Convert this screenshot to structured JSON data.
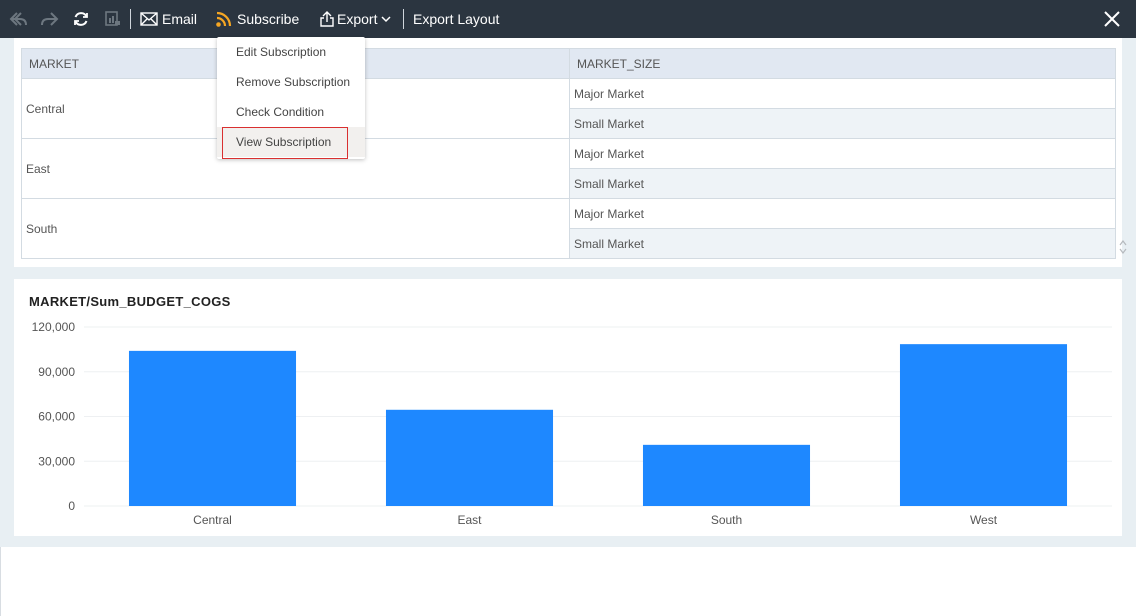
{
  "toolbar": {
    "undo_label": "Undo",
    "redo_label": "Redo",
    "refresh_label": "Refresh",
    "email_label": "Email",
    "subscribe_label": "Subscribe",
    "export_label": "Export",
    "export_layout_label": "Export Layout",
    "subscribe_icon_color": "#f5a623"
  },
  "subscribe_menu": {
    "items": [
      {
        "label": "Edit Subscription"
      },
      {
        "label": "Remove Subscription"
      },
      {
        "label": "Check Condition"
      },
      {
        "label": "View Subscription",
        "selected": true
      }
    ]
  },
  "table": {
    "headers": [
      "MARKET",
      "MARKET_SIZE"
    ],
    "groups": [
      {
        "market": "Central",
        "sizes": [
          "Major Market",
          "Small Market"
        ]
      },
      {
        "market": "East",
        "sizes": [
          "Major Market",
          "Small Market"
        ]
      },
      {
        "market": "South",
        "sizes": [
          "Major Market",
          "Small Market"
        ]
      }
    ]
  },
  "chart_data": {
    "type": "bar",
    "title": "MARKET/Sum_BUDGET_COGS",
    "categories": [
      "Central",
      "East",
      "South",
      "West"
    ],
    "values": [
      104000,
      64500,
      41000,
      108500
    ],
    "xlabel": "",
    "ylabel": "",
    "ylim": [
      0,
      120000
    ],
    "yticks": [
      0,
      30000,
      60000,
      90000,
      120000
    ],
    "ytick_labels": [
      "0",
      "30,000",
      "60,000",
      "90,000",
      "120,000"
    ],
    "grid": true,
    "legend": "none",
    "bar_color": "#1e88ff"
  }
}
